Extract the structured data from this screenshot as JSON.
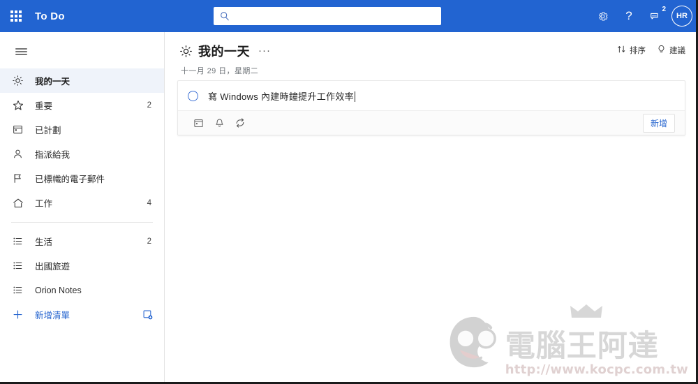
{
  "header": {
    "app_launcher_icon": "waffle-grid-icon",
    "brand": "To Do",
    "search": {
      "value": "",
      "placeholder": "",
      "icon": "search-icon"
    },
    "settings_icon": "gear-icon",
    "help_label": "?",
    "feedback_icon": "feedback-icon",
    "feedback_badge": "2",
    "avatar_initials": "HR",
    "brand_color": "#2264D1"
  },
  "sidebar": {
    "menu_icon": "hamburger-icon",
    "items": [
      {
        "label": "我的一天",
        "icon": "sun-icon",
        "count": "",
        "selected": true
      },
      {
        "label": "重要",
        "icon": "star-icon",
        "count": "2",
        "selected": false
      },
      {
        "label": "已計劃",
        "icon": "calendar-icon",
        "count": "",
        "selected": false
      },
      {
        "label": "指派給我",
        "icon": "person-icon",
        "count": "",
        "selected": false
      },
      {
        "label": "已標幟的電子郵件",
        "icon": "flag-icon",
        "count": "",
        "selected": false
      },
      {
        "label": "工作",
        "icon": "home-icon",
        "count": "4",
        "selected": false
      }
    ],
    "lists": [
      {
        "label": "生活",
        "icon": "list-icon",
        "count": "2"
      },
      {
        "label": "出國旅遊",
        "icon": "list-icon",
        "count": ""
      },
      {
        "label": "Orion Notes",
        "icon": "list-icon",
        "count": ""
      }
    ],
    "new_list": {
      "label": "新增清單",
      "icon": "plus-icon",
      "group_icon": "new-group-icon"
    },
    "accent_color": "#2564cf"
  },
  "main": {
    "title": "我的一天",
    "title_icon": "sun-icon",
    "more_label": "···",
    "subtitle": "十一月 29 日，星期二",
    "actions": [
      {
        "label": "排序",
        "icon": "sort-icon"
      },
      {
        "label": "建議",
        "icon": "lightbulb-icon"
      }
    ],
    "add_task": {
      "checkbox_icon": "circle-checkbox-icon",
      "text": "寫 Windows 內建時鐘提升工作效率",
      "tools": [
        {
          "icon": "due-date-calendar-icon"
        },
        {
          "icon": "reminder-bell-icon"
        },
        {
          "icon": "repeat-icon"
        }
      ],
      "add_label": "新增"
    }
  },
  "watermark": {
    "brand_cn": "電腦王阿達",
    "url": "http://www.kocpc.com.tw",
    "face_icon": "mascot-face-icon",
    "crown_icon": "crown-icon"
  }
}
